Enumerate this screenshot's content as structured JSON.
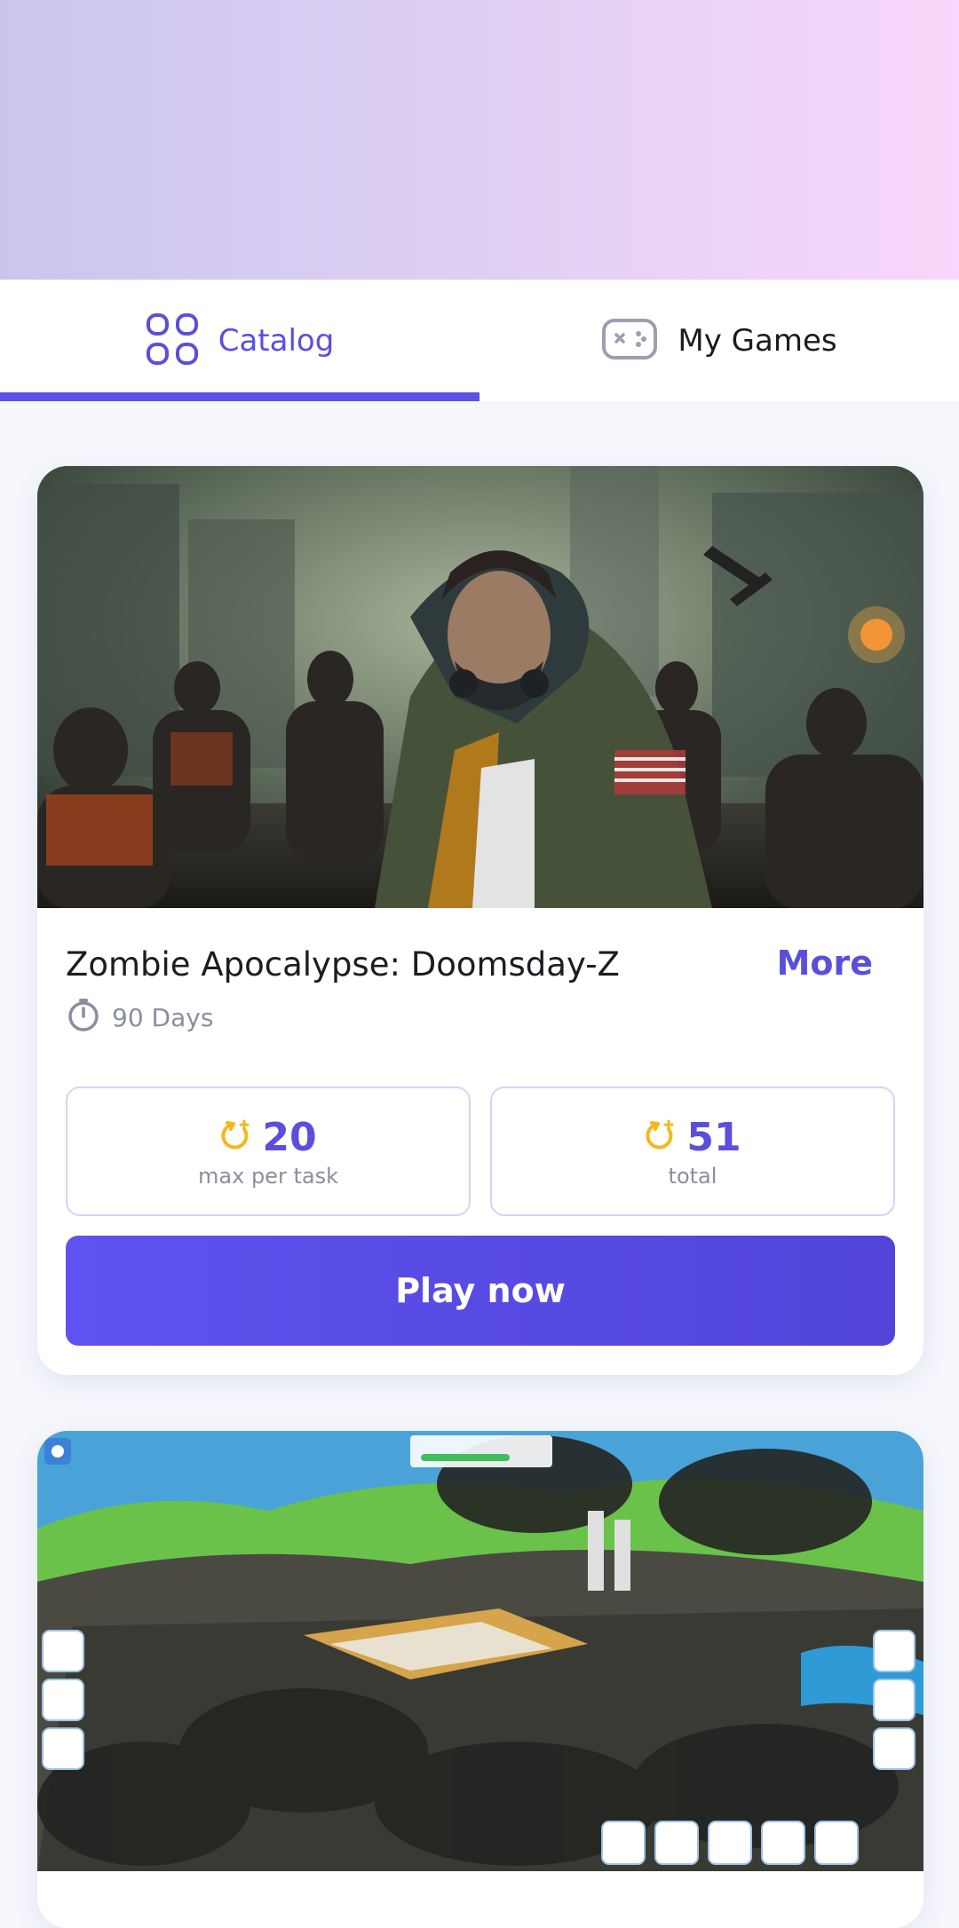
{
  "tabs": {
    "catalog_label": "Catalog",
    "my_games_label": "My Games",
    "active": "catalog"
  },
  "games": [
    {
      "title": "Zombie Apocalypse: Doomsday-Z",
      "more_label": "More",
      "duration": "90 Days",
      "stats": [
        {
          "value": "20",
          "label": "max per task"
        },
        {
          "value": "51",
          "label": "total"
        }
      ],
      "play_label": "Play now",
      "image_icon": "zombie-apocalypse-artwork"
    },
    {
      "image_icon": "city-builder-game-screenshot"
    }
  ],
  "icons": {
    "catalog": "grid-icon",
    "my_games": "gamepad-icon",
    "duration": "timer-icon",
    "stat": "coin-refresh-icon"
  },
  "colors": {
    "accent": "#5a4fdc",
    "stat_icon": "#f4b81c",
    "muted_text": "#8a8f9e"
  }
}
